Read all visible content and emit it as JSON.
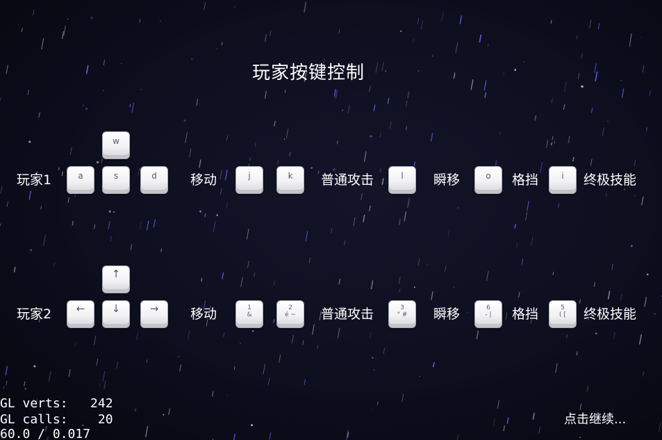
{
  "title": "玩家按键控制",
  "player1": {
    "name": "玩家1",
    "keys": {
      "up": "w",
      "left": "a",
      "down": "s",
      "right": "d",
      "attack1": "j",
      "attack2": "k",
      "teleport": "l",
      "block": "o",
      "ultimate": "i"
    }
  },
  "player2": {
    "name": "玩家2",
    "keys": {
      "up": "↑",
      "left": "←",
      "down": "↓",
      "right": "→",
      "attack1": "1\n&",
      "attack2": "2\né ~",
      "teleport": "3\n\" #",
      "block": "6\n- |",
      "ultimate": "5\n( [",
      "arrow_icons": [
        "arrow-up-icon",
        "arrow-left-icon",
        "arrow-down-icon",
        "arrow-right-icon"
      ]
    }
  },
  "actions": {
    "move": "移动",
    "attack": "普通攻击",
    "teleport": "瞬移",
    "block": "格挡",
    "ultimate": "终极技能"
  },
  "debug": {
    "line1": "GL verts:   242",
    "line2": "GL calls:    20",
    "line3": "60.0 / 0.017"
  },
  "continue_text": "点击继续...",
  "colors": {
    "background": "#0d0e1e",
    "text": "#ffffff",
    "key_face": "#f2f2f4",
    "key_text": "#5a5a66",
    "star_blue": "#6f6cff"
  }
}
